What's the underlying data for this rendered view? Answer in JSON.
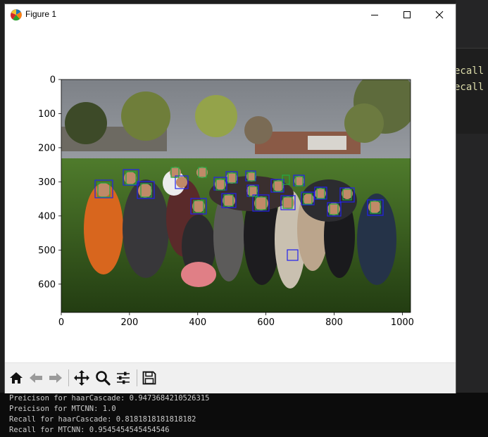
{
  "window": {
    "title": "Figure 1"
  },
  "background_editor": {
    "lines": [
      "ecall",
      "ecall"
    ]
  },
  "plot": {
    "x_ticks": [
      0,
      200,
      400,
      600,
      800,
      1000
    ],
    "y_ticks": [
      0,
      100,
      200,
      300,
      400,
      500,
      600
    ],
    "xlim": [
      0,
      1024
    ],
    "ylim": [
      683,
      0
    ],
    "box_colors": {
      "haar": "#2222ee",
      "mtcnn": "#22aa44"
    }
  },
  "toolbar": {
    "icons": [
      "home-icon",
      "back-icon",
      "forward-icon",
      "pan-icon",
      "zoom-icon",
      "configure-subplots-icon",
      "save-icon"
    ]
  },
  "console": {
    "lines": [
      "Preicison for haarCascade: 0.9473684210526315",
      "Preicison for MTCNN: 1.0",
      "Recall for haarCascade: 0.8181818181818182",
      "Recall for MTCNN: 0.9545454545454546"
    ]
  }
}
